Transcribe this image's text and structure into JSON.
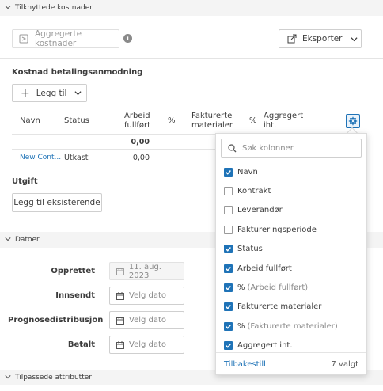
{
  "related_costs": {
    "header": "Tilknyttede kostnader",
    "aggregate_button": "Aggregerte kostnader",
    "export_button": "Eksporter"
  },
  "cost_payment": {
    "title": "Kostnad betalingsanmodning",
    "add_button": "Legg til",
    "columns": {
      "name": "Navn",
      "status": "Status",
      "work_done_1": "Arbeid",
      "work_done_2": "fullført",
      "percent1": "%",
      "invoiced_1": "Fakturerte",
      "invoiced_2": "materialer",
      "percent2": "%",
      "aggregated_1": "Aggregert",
      "aggregated_2": "iht."
    },
    "total_work": "0,00",
    "row": {
      "name": "New Cont...",
      "status": "Utkast",
      "work": "0,00"
    }
  },
  "expense": {
    "title": "Utgift",
    "add_existing_button": "Legg til eksisterende"
  },
  "dates": {
    "header": "Datoer",
    "created_label": "Opprettet",
    "created_value": "11. aug. 2023",
    "submitted_label": "Innsendt",
    "forecast_label": "Prognosedistribusjon",
    "paid_label": "Betalt",
    "placeholder": "Velg dato"
  },
  "custom_attributes": {
    "header": "Tilpassede attributter"
  },
  "column_picker": {
    "search_placeholder": "Søk kolonner",
    "options": [
      {
        "label": "Navn",
        "suffix": "",
        "checked": true
      },
      {
        "label": "Kontrakt",
        "suffix": "",
        "checked": false
      },
      {
        "label": "Leverandør",
        "suffix": "",
        "checked": false
      },
      {
        "label": "Faktureringsperiode",
        "suffix": "",
        "checked": false
      },
      {
        "label": "Status",
        "suffix": "",
        "checked": true
      },
      {
        "label": "Arbeid fullført",
        "suffix": "",
        "checked": true
      },
      {
        "label": "%",
        "suffix": "(Arbeid fullført)",
        "checked": true
      },
      {
        "label": "Fakturerte materialer",
        "suffix": "",
        "checked": true
      },
      {
        "label": "%",
        "suffix": "(Fakturerte materialer)",
        "checked": true
      },
      {
        "label": "Aggregert iht.",
        "suffix": "",
        "checked": true
      }
    ],
    "reset_link": "Tilbakestill",
    "selected_count": "7 valgt"
  },
  "colors": {
    "accent": "#1f73b7",
    "section_bg": "#f4f4f4"
  }
}
